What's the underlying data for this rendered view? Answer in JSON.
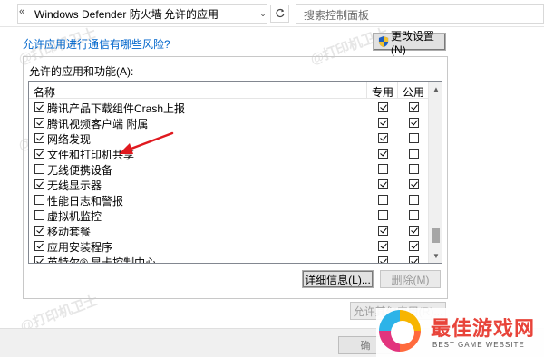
{
  "address_bar": {
    "nav_prefix": "«",
    "crumbs": [
      "Windows Defender 防火墙",
      "允许的应用"
    ],
    "separator": "›",
    "dropdown_glyph": "⌄",
    "search_placeholder": "搜索控制面板"
  },
  "content": {
    "risk_link": "允许应用进行通信有哪些风险?",
    "change_settings_label": "更改设置(N)",
    "group_label": "允许的应用和功能(A):",
    "columns": {
      "name": "名称",
      "private": "专用",
      "public": "公用"
    },
    "rows": [
      {
        "name": "腾讯产品下载组件Crash上报",
        "enabled": true,
        "private": true,
        "public": true
      },
      {
        "name": "腾讯视频客户端 附属",
        "enabled": true,
        "private": true,
        "public": true
      },
      {
        "name": "网络发现",
        "enabled": true,
        "private": true,
        "public": false
      },
      {
        "name": "文件和打印机共享",
        "enabled": true,
        "private": true,
        "public": false
      },
      {
        "name": "无线便携设备",
        "enabled": false,
        "private": false,
        "public": false
      },
      {
        "name": "无线显示器",
        "enabled": true,
        "private": true,
        "public": true
      },
      {
        "name": "性能日志和警报",
        "enabled": false,
        "private": false,
        "public": false
      },
      {
        "name": "虚拟机监控",
        "enabled": false,
        "private": false,
        "public": false
      },
      {
        "name": "移动套餐",
        "enabled": true,
        "private": true,
        "public": true
      },
      {
        "name": "应用安装程序",
        "enabled": true,
        "private": true,
        "public": true
      },
      {
        "name": "英特尔® 显卡控制中心",
        "enabled": true,
        "private": true,
        "public": true
      }
    ],
    "details_label": "详细信息(L)...",
    "delete_label": "删除(M)",
    "allow_other_label": "允许其他应用(R)...",
    "footer_ok_label": "确"
  },
  "logo": {
    "title": "最佳游戏网",
    "subtitle": "BEST GAME WEBSITE"
  },
  "watermark": "@打印机卫士",
  "colors": {
    "link": "#0066cc",
    "arrow": "#e0191f",
    "logo_red": "#e8443a"
  }
}
